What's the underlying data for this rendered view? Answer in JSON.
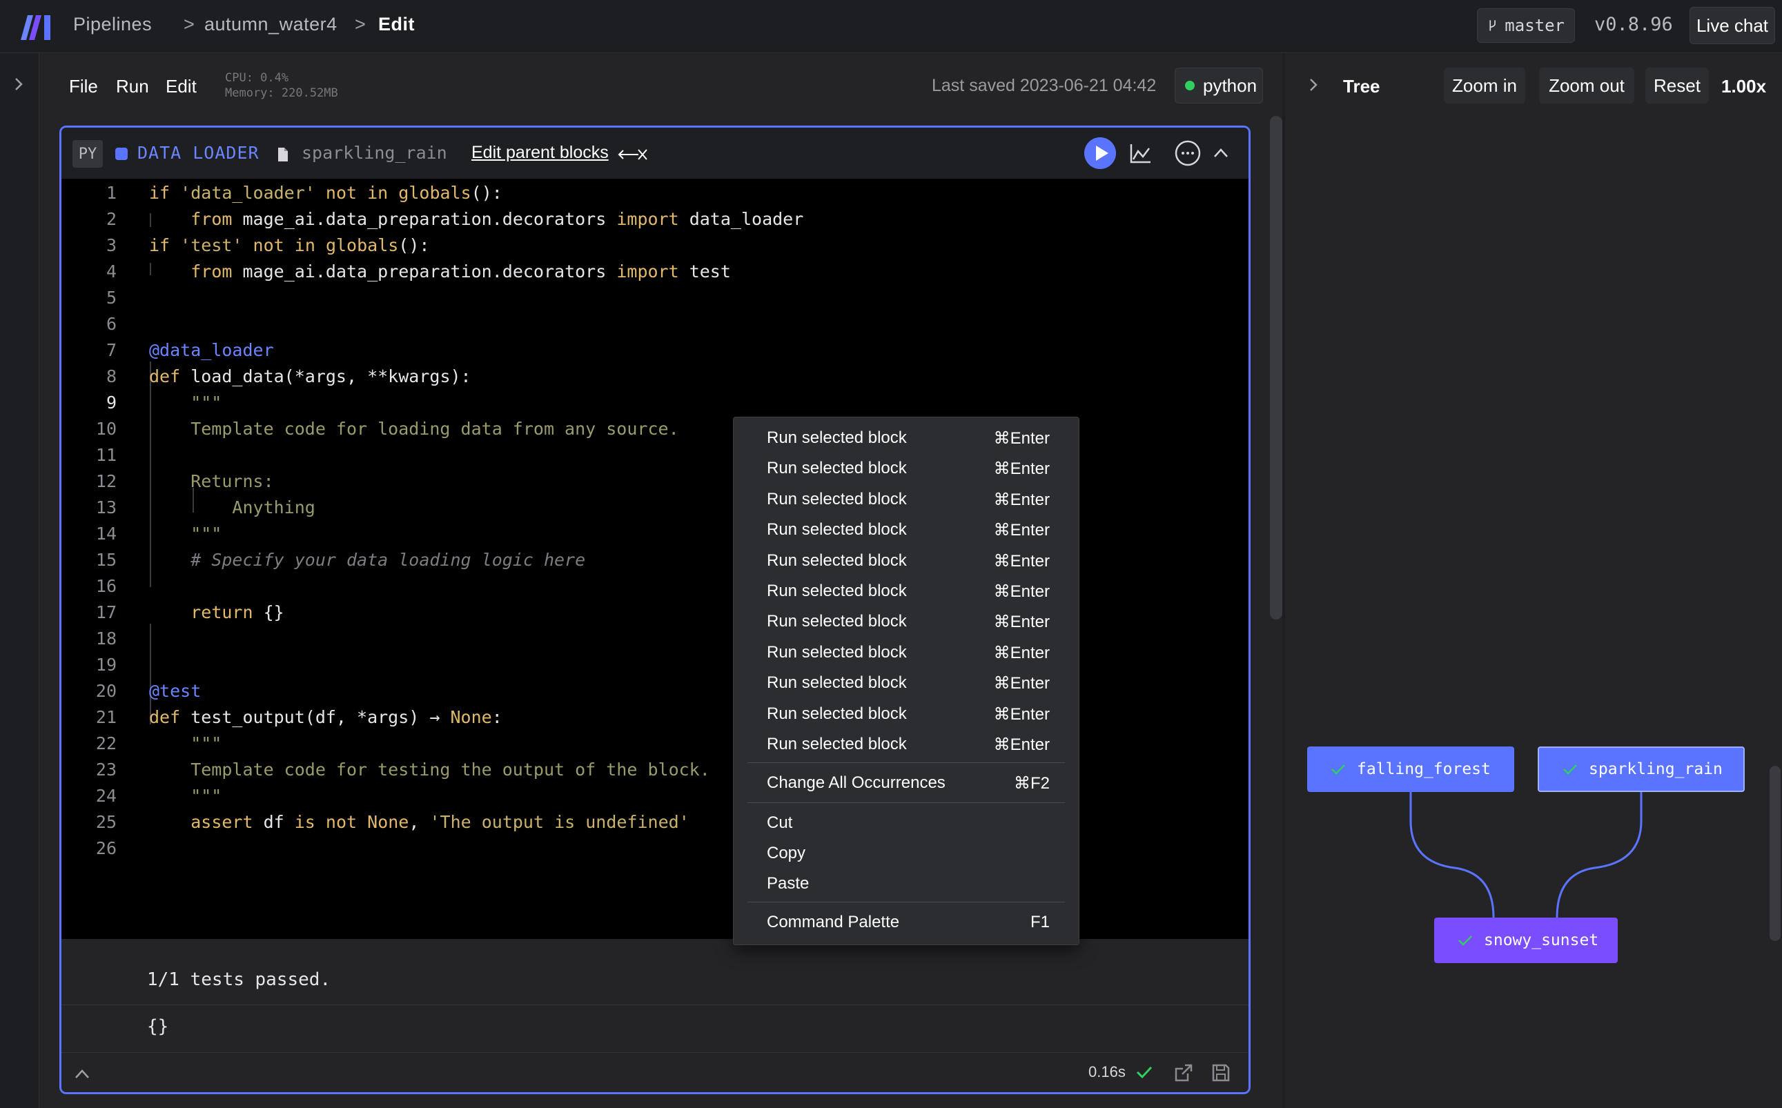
{
  "header": {
    "breadcrumbs": [
      "Pipelines",
      "autumn_water4",
      "Edit"
    ],
    "branch": "master",
    "version": "v0.8.96",
    "live_chat": "Live chat"
  },
  "toolbar": {
    "menu": [
      "File",
      "Run",
      "Edit"
    ],
    "cpu": "CPU: 0.4%",
    "memory": "Memory: 220.52MB",
    "last_saved": "Last saved 2023-06-21 04:42",
    "kernel": "python"
  },
  "block": {
    "lang_badge": "PY",
    "type_label": "DATA LOADER",
    "name": "sparkling_rain",
    "edit_parents": "Edit parent blocks",
    "line_numbers": [
      "1",
      "2",
      "3",
      "4",
      "5",
      "6",
      "7",
      "8",
      "9",
      "10",
      "11",
      "12",
      "13",
      "14",
      "15",
      "16",
      "17",
      "18",
      "19",
      "20",
      "21",
      "22",
      "23",
      "24",
      "25",
      "26"
    ],
    "code_lines": [
      "if 'data_loader' not in globals():",
      "    from mage_ai.data_preparation.decorators import data_loader",
      "if 'test' not in globals():",
      "    from mage_ai.data_preparation.decorators import test",
      "",
      "",
      "@data_loader",
      "def load_data(*args, **kwargs):",
      "    \"\"\"",
      "    Template code for loading data from any source.",
      "",
      "    Returns:",
      "        Anything",
      "    \"\"\"",
      "    # Specify your data loading logic here",
      "",
      "    return {}",
      "",
      "",
      "@test",
      "def test_output(df, *args) → None:",
      "    \"\"\"",
      "    Template code for testing the output of the block.",
      "    \"\"\"",
      "    assert df is not None, 'The output is undefined'",
      ""
    ],
    "output_line1": "1/1 tests passed.",
    "output_line2": "{}",
    "runtime": "0.16s"
  },
  "context_menu": {
    "items": [
      {
        "label": "Run selected block",
        "shortcut": "⌘Enter"
      },
      {
        "label": "Run selected block",
        "shortcut": "⌘Enter"
      },
      {
        "label": "Run selected block",
        "shortcut": "⌘Enter"
      },
      {
        "label": "Run selected block",
        "shortcut": "⌘Enter"
      },
      {
        "label": "Run selected block",
        "shortcut": "⌘Enter"
      },
      {
        "label": "Run selected block",
        "shortcut": "⌘Enter"
      },
      {
        "label": "Run selected block",
        "shortcut": "⌘Enter"
      },
      {
        "label": "Run selected block",
        "shortcut": "⌘Enter"
      },
      {
        "label": "Run selected block",
        "shortcut": "⌘Enter"
      },
      {
        "label": "Run selected block",
        "shortcut": "⌘Enter"
      },
      {
        "label": "Run selected block",
        "shortcut": "⌘Enter"
      }
    ],
    "change_all": {
      "label": "Change All Occurrences",
      "shortcut": "⌘F2"
    },
    "cut": "Cut",
    "copy": "Copy",
    "paste": "Paste",
    "palette": {
      "label": "Command Palette",
      "shortcut": "F1"
    }
  },
  "tree_panel": {
    "title": "Tree",
    "zoom_in": "Zoom in",
    "zoom_out": "Zoom out",
    "reset": "Reset",
    "zoom_level": "1.00x",
    "nodes": [
      {
        "name": "falling_forest",
        "color": "#5a74ff"
      },
      {
        "name": "sparkling_rain",
        "color": "#5a74ff"
      },
      {
        "name": "snowy_sunset",
        "color": "#7a4dff"
      }
    ]
  },
  "colors": {
    "accent": "#5a74ff",
    "transformer": "#7a4dff",
    "success": "#2fd05d"
  }
}
